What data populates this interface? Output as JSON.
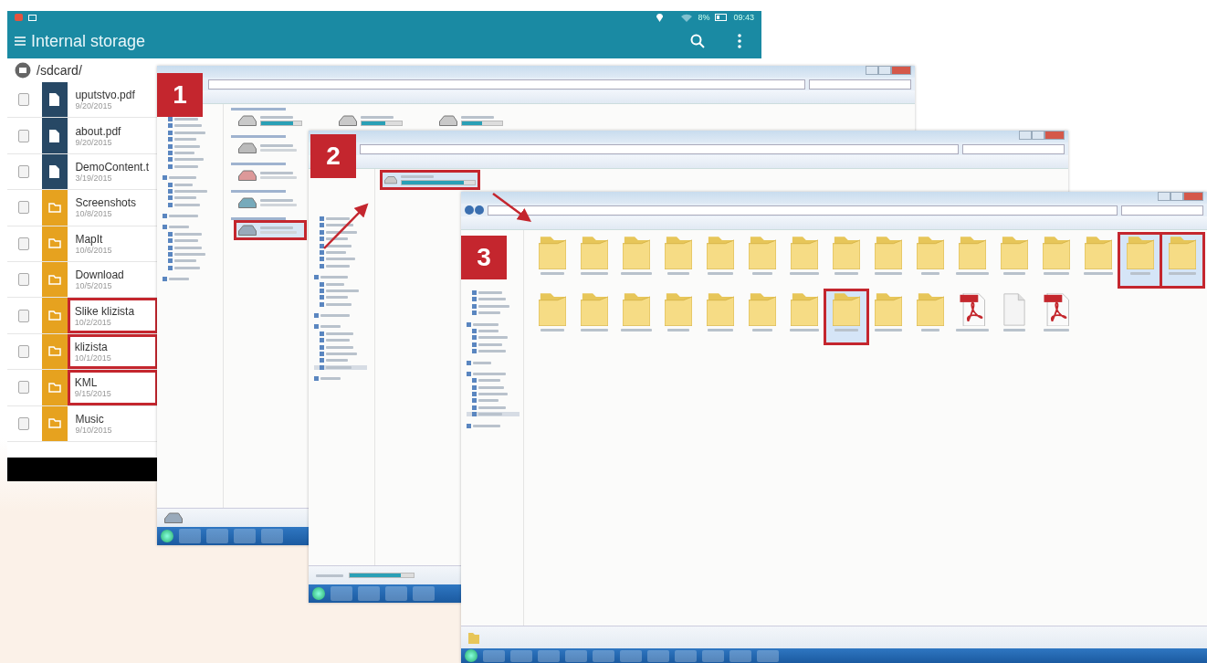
{
  "android": {
    "battery": "8%",
    "time": "09:43",
    "title": "Internal storage",
    "path": "/sdcard/",
    "files": [
      {
        "kind": "pdf",
        "name": "uputstvo.pdf",
        "date": "9/20/2015",
        "checked": false,
        "highlighted": false
      },
      {
        "kind": "pdf",
        "name": "about.pdf",
        "date": "9/20/2015",
        "checked": false,
        "highlighted": false
      },
      {
        "kind": "txt",
        "name": "DemoContent.t",
        "date": "3/19/2015",
        "checked": false,
        "highlighted": false
      },
      {
        "kind": "folder",
        "name": "Screenshots",
        "date": "10/8/2015",
        "checked": false,
        "highlighted": false
      },
      {
        "kind": "folder",
        "name": "MapIt",
        "date": "10/6/2015",
        "checked": false,
        "highlighted": false
      },
      {
        "kind": "folder",
        "name": "Download",
        "date": "10/5/2015",
        "checked": false,
        "highlighted": false
      },
      {
        "kind": "folder",
        "name": "Slike klizista",
        "date": "10/2/2015",
        "checked": false,
        "highlighted": true
      },
      {
        "kind": "folder",
        "name": "klizista",
        "date": "10/1/2015",
        "checked": false,
        "highlighted": true
      },
      {
        "kind": "folder",
        "name": "KML",
        "date": "9/15/2015",
        "checked": false,
        "highlighted": true
      },
      {
        "kind": "folder",
        "name": "Music",
        "date": "9/10/2015",
        "checked": false,
        "highlighted": false
      }
    ]
  },
  "windows": [
    {
      "kind": "drives",
      "step": "1",
      "nav": [
        {
          "kind": "item",
          "selected": false
        },
        {
          "kind": "item",
          "selected": false
        },
        {
          "kind": "item",
          "selected": false
        },
        {
          "kind": "item",
          "selected": false
        },
        {
          "kind": "item",
          "selected": false
        },
        {
          "kind": "item",
          "selected": false
        },
        {
          "kind": "item",
          "selected": false
        },
        {
          "kind": "item",
          "selected": false
        },
        {
          "kind": "header",
          "selected": false
        },
        {
          "kind": "item",
          "selected": false
        },
        {
          "kind": "item",
          "selected": false
        },
        {
          "kind": "item",
          "selected": false
        },
        {
          "kind": "item",
          "selected": false
        },
        {
          "kind": "header",
          "selected": false
        },
        {
          "kind": "header",
          "selected": false
        },
        {
          "kind": "item",
          "selected": false
        },
        {
          "kind": "item",
          "selected": false
        },
        {
          "kind": "item",
          "selected": false
        },
        {
          "kind": "item",
          "selected": false
        },
        {
          "kind": "item",
          "selected": false
        },
        {
          "kind": "item",
          "selected": false
        },
        {
          "kind": "header",
          "selected": false
        }
      ],
      "groups": [
        {
          "items": [
            {
              "kind": "disk",
              "level": 0.8,
              "highlighted": false
            },
            {
              "kind": "disk",
              "level": 0.6,
              "highlighted": false
            },
            {
              "kind": "disk",
              "level": 0.5,
              "highlighted": false
            }
          ]
        },
        {
          "items": [
            {
              "kind": "optical",
              "highlighted": false
            }
          ]
        },
        {
          "items": [
            {
              "kind": "network",
              "highlighted": false
            }
          ]
        },
        {
          "items": [
            {
              "kind": "cloud",
              "highlighted": false
            }
          ]
        },
        {
          "items": [
            {
              "kind": "player",
              "highlighted": true
            }
          ]
        }
      ]
    },
    {
      "kind": "device",
      "step": "2",
      "nav": [
        {
          "kind": "item",
          "selected": false
        },
        {
          "kind": "item",
          "selected": false
        },
        {
          "kind": "item",
          "selected": false
        },
        {
          "kind": "item",
          "selected": false
        },
        {
          "kind": "item",
          "selected": false
        },
        {
          "kind": "item",
          "selected": false
        },
        {
          "kind": "item",
          "selected": false
        },
        {
          "kind": "item",
          "selected": false
        },
        {
          "kind": "header",
          "selected": false
        },
        {
          "kind": "item",
          "selected": false
        },
        {
          "kind": "item",
          "selected": false
        },
        {
          "kind": "item",
          "selected": false
        },
        {
          "kind": "item",
          "selected": false
        },
        {
          "kind": "header",
          "selected": false
        },
        {
          "kind": "header",
          "selected": false
        },
        {
          "kind": "item",
          "selected": false
        },
        {
          "kind": "item",
          "selected": false
        },
        {
          "kind": "item",
          "selected": false
        },
        {
          "kind": "item",
          "selected": false
        },
        {
          "kind": "item",
          "selected": false
        },
        {
          "kind": "item",
          "selected": true
        },
        {
          "kind": "header",
          "selected": false
        }
      ],
      "storage": {
        "level": 0.85,
        "highlighted": true
      },
      "space": {
        "level": 0.8
      }
    },
    {
      "kind": "folders",
      "step": "3",
      "nav": [
        {
          "kind": "item",
          "selected": false
        },
        {
          "kind": "item",
          "selected": false
        },
        {
          "kind": "item",
          "selected": false
        },
        {
          "kind": "item",
          "selected": false
        },
        {
          "kind": "header",
          "selected": false
        },
        {
          "kind": "item",
          "selected": false
        },
        {
          "kind": "item",
          "selected": false
        },
        {
          "kind": "item",
          "selected": false
        },
        {
          "kind": "item",
          "selected": false
        },
        {
          "kind": "header",
          "selected": false
        },
        {
          "kind": "header",
          "selected": false
        },
        {
          "kind": "item",
          "selected": false
        },
        {
          "kind": "item",
          "selected": false
        },
        {
          "kind": "item",
          "selected": false
        },
        {
          "kind": "item",
          "selected": false
        },
        {
          "kind": "item",
          "selected": false
        },
        {
          "kind": "item",
          "selected": true
        },
        {
          "kind": "header",
          "selected": false
        }
      ],
      "items": [
        {
          "kind": "folder",
          "selected": false,
          "highlighted": false
        },
        {
          "kind": "folder",
          "selected": false,
          "highlighted": false
        },
        {
          "kind": "folder",
          "selected": false,
          "highlighted": false
        },
        {
          "kind": "folder",
          "selected": false,
          "highlighted": false
        },
        {
          "kind": "folder",
          "selected": false,
          "highlighted": false
        },
        {
          "kind": "folder",
          "selected": false,
          "highlighted": false
        },
        {
          "kind": "folder",
          "selected": false,
          "highlighted": false
        },
        {
          "kind": "folder",
          "selected": false,
          "highlighted": false
        },
        {
          "kind": "folder",
          "selected": false,
          "highlighted": false
        },
        {
          "kind": "folder",
          "selected": false,
          "highlighted": false
        },
        {
          "kind": "folder",
          "selected": false,
          "highlighted": false
        },
        {
          "kind": "folder",
          "selected": false,
          "highlighted": false
        },
        {
          "kind": "folder",
          "selected": false,
          "highlighted": false
        },
        {
          "kind": "folder",
          "selected": false,
          "highlighted": false
        },
        {
          "kind": "folder",
          "selected": true,
          "highlighted": true
        },
        {
          "kind": "folder",
          "selected": true,
          "highlighted": true
        },
        {
          "kind": "folder",
          "selected": false,
          "highlighted": false
        },
        {
          "kind": "folder",
          "selected": false,
          "highlighted": false
        },
        {
          "kind": "folder",
          "selected": false,
          "highlighted": false
        },
        {
          "kind": "folder",
          "selected": false,
          "highlighted": false
        },
        {
          "kind": "folder",
          "selected": false,
          "highlighted": false
        },
        {
          "kind": "folder",
          "selected": false,
          "highlighted": false
        },
        {
          "kind": "folder",
          "selected": false,
          "highlighted": false
        },
        {
          "kind": "folder",
          "selected": true,
          "highlighted": true
        },
        {
          "kind": "folder",
          "selected": false,
          "highlighted": false
        },
        {
          "kind": "folder",
          "selected": false,
          "highlighted": false
        },
        {
          "kind": "pdf",
          "selected": false,
          "highlighted": false
        },
        {
          "kind": "txt",
          "selected": false,
          "highlighted": false
        },
        {
          "kind": "pdf",
          "selected": false,
          "highlighted": false
        }
      ]
    }
  ]
}
